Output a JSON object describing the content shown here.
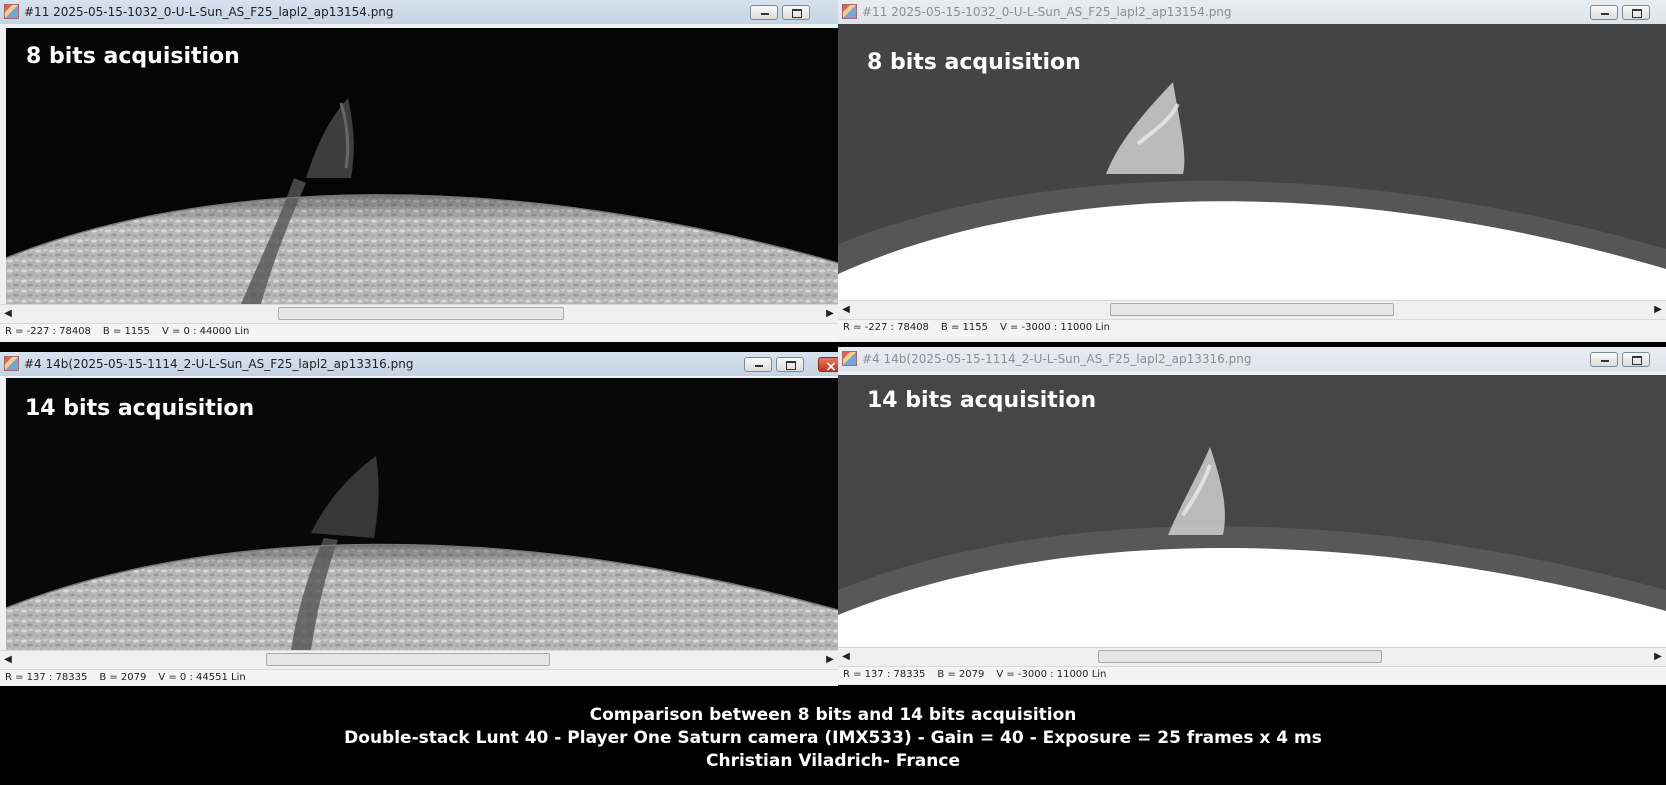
{
  "windows": [
    {
      "id": "tl",
      "title": "#11 2025-05-15-1032_0-U-L-Sun_AS_F25_lapl2_ap13154.png",
      "overlay": "8 bits acquisition",
      "status": {
        "r": "R = -227 : 78408",
        "b": "B = 1155",
        "v": "V = 0 : 44000 Lin"
      }
    },
    {
      "id": "tr",
      "title": "#11 2025-05-15-1032_0-U-L-Sun_AS_F25_lapl2_ap13154.png",
      "overlay": "8 bits acquisition",
      "status": {
        "r": "R = -227 : 78408",
        "b": "B = 1155",
        "v": "V = -3000 : 11000 Lin"
      }
    },
    {
      "id": "bl",
      "title": "#4 14b(2025-05-15-1114_2-U-L-Sun_AS_F25_lapl2_ap13316.png",
      "overlay": "14 bits acquisition",
      "status": {
        "r": "R = 137 : 78335",
        "b": "B = 2079",
        "v": "V = 0 : 44551 Lin"
      }
    },
    {
      "id": "br",
      "title": "#4 14b(2025-05-15-1114_2-U-L-Sun_AS_F25_lapl2_ap13316.png",
      "overlay": "14 bits acquisition",
      "status": {
        "r": "R = 137 : 78335",
        "b": "B = 2079",
        "v": "V = -3000 : 11000 Lin"
      }
    }
  ],
  "caption": {
    "line1": "Comparison between 8 bits and 14 bits acquisition",
    "line2": "Double-stack Lunt 40 - Player One Saturn camera (IMX533) - Gain = 40 - Exposure = 25 frames x 4 ms",
    "line3": "Christian Viladrich- France"
  },
  "icons": {
    "app": "image-window-icon",
    "minimize": "minimize-icon",
    "maximize": "maximize-icon",
    "close": "close-icon",
    "scroll_left": "arrow-left-icon",
    "scroll_right": "arrow-right-icon"
  },
  "colors": {
    "titlebar_active": "#c4d3e3",
    "close_button": "#c6341c",
    "sky_high_contrast": "#050505",
    "sky_stretched": "#454545",
    "disk_stretched": "#ffffff"
  }
}
